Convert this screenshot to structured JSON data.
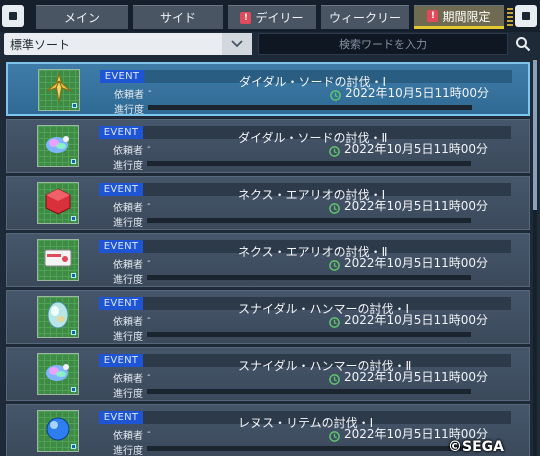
{
  "tabs": [
    {
      "label": "メイン",
      "alert": false,
      "active": false
    },
    {
      "label": "サイド",
      "alert": false,
      "active": false
    },
    {
      "label": "デイリー",
      "alert": true,
      "active": false
    },
    {
      "label": "ウィークリー",
      "alert": false,
      "active": false
    },
    {
      "label": "期間限定",
      "alert": true,
      "active": true
    }
  ],
  "alert_mark": "!",
  "sort": {
    "label": "標準ソート"
  },
  "search": {
    "placeholder": "検索ワードを入力"
  },
  "list_labels": {
    "event_badge": "EVENT",
    "client": "依頼者",
    "client_value": "-",
    "progress": "進行度"
  },
  "quests": [
    {
      "title": "ダイダル・ソードの討伐・Ⅰ",
      "deadline": "2022年10月5日11時00分",
      "progress": 0,
      "selected": true,
      "icon": "sword-crest-icon"
    },
    {
      "title": "ダイダル・ソードの討伐・Ⅱ",
      "deadline": "2022年10月5日11時00分",
      "progress": 0,
      "selected": false,
      "icon": "rainbow-gem-icon"
    },
    {
      "title": "ネクス・エアリオの討伐・Ⅰ",
      "deadline": "2022年10月5日11時00分",
      "progress": 0,
      "selected": false,
      "icon": "red-cube-icon"
    },
    {
      "title": "ネクス・エアリオの討伐・Ⅱ",
      "deadline": "2022年10月5日11時00分",
      "progress": 0,
      "selected": false,
      "icon": "ticket-icon"
    },
    {
      "title": "スナイダル・ハンマーの討伐・Ⅰ",
      "deadline": "2022年10月5日11時00分",
      "progress": 0,
      "selected": false,
      "icon": "crystal-egg-icon"
    },
    {
      "title": "スナイダル・ハンマーの討伐・Ⅱ",
      "deadline": "2022年10月5日11時00分",
      "progress": 0,
      "selected": false,
      "icon": "rainbow-gem-icon"
    },
    {
      "title": "レヌス・リテムの討伐・Ⅰ",
      "deadline": "2022年10月5日11時00分",
      "progress": 0,
      "selected": false,
      "icon": "blue-orb-icon"
    }
  ],
  "copyright": "©SEGA",
  "colors": {
    "accent_tab": "#e3c832",
    "selected_row": "#3f7ca8",
    "event_badge": "#1e55d4",
    "clock": "#5fc46e"
  }
}
